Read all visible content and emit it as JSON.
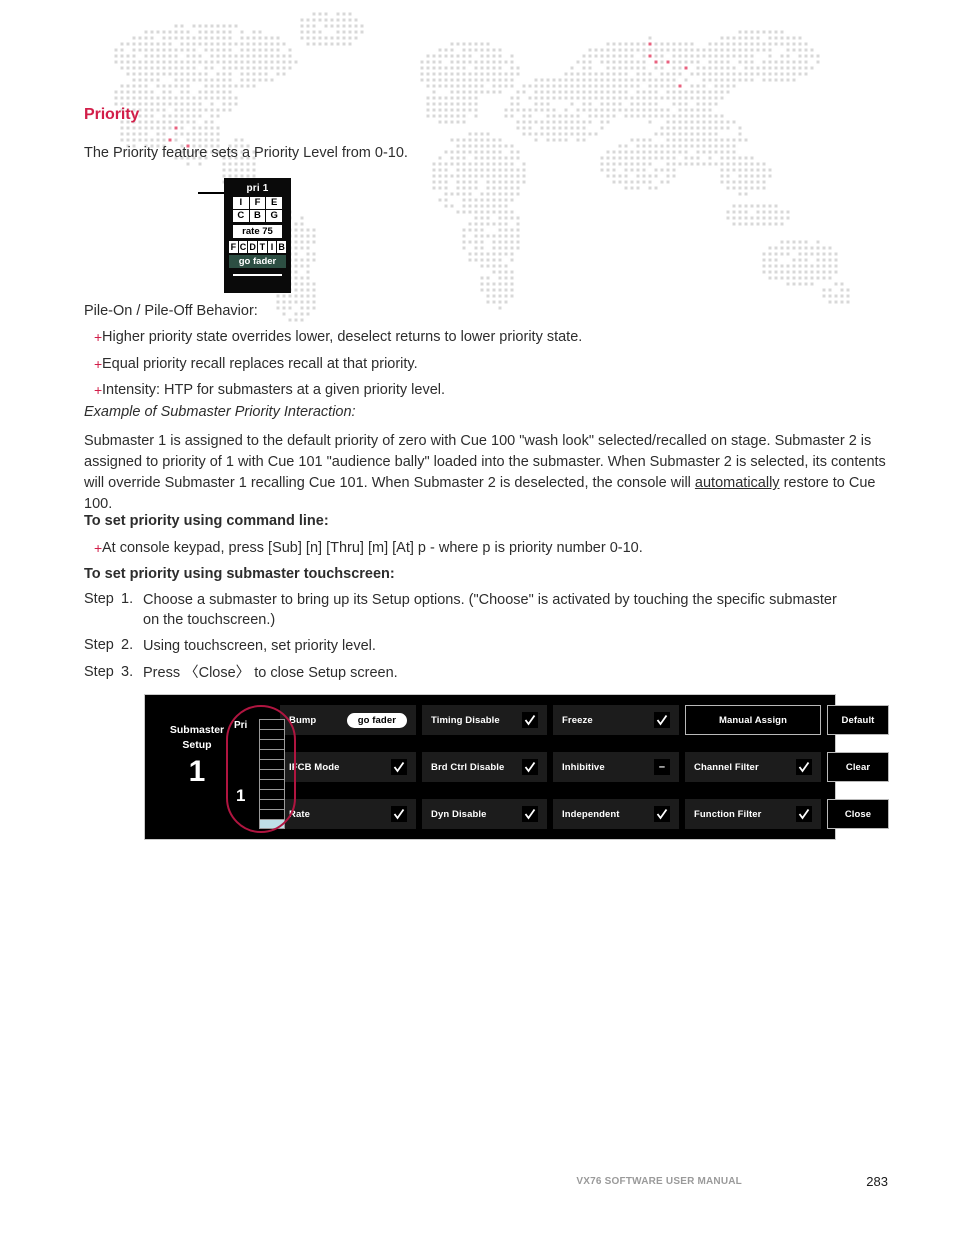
{
  "document": {
    "heading": "Priority",
    "intro": "The Priority feature sets a Priority Level from 0-10."
  },
  "fader_widget": {
    "pri_label": "pri 1",
    "ifcb_grid": [
      "I",
      "F",
      "E",
      "C",
      "B",
      "G"
    ],
    "rate": "rate 75",
    "fcdtib": [
      "F",
      "C",
      "D",
      "T",
      "I",
      "B"
    ],
    "go_fader": "go fader"
  },
  "pile_section": {
    "heading": "Pile-On / Pile-Off Behavior:",
    "bullets": [
      "Higher priority state overrides lower, deselect returns to lower priority state.",
      "Equal priority recall replaces recall at that priority.",
      "Intensity: HTP for submasters at a given priority level."
    ]
  },
  "example": {
    "heading": "Example of Submaster Priority Interaction:",
    "paragraph_part1": "Submaster 1 is assigned to the default priority of zero with Cue 100 \"wash look\" selected/recalled on stage. Submaster 2 is assigned to priority of 1 with Cue 101 \"audience bally\" loaded into the submaster. When Submaster 2 is selected, its contents will override Submaster 1 recalling Cue 101. When Submaster 2 is deselected, the console will ",
    "paragraph_underlined": "automatically",
    "paragraph_part2": " restore to Cue 100."
  },
  "command_line": {
    "heading": "To set priority using command line:",
    "bullets": [
      "At console keypad, press [Sub] [n] [Thru] [m] [At] p - where p is priority number 0-10."
    ]
  },
  "touchscreen_steps": {
    "heading": "To set priority using submaster touchscreen:",
    "step_word": "Step",
    "steps": [
      {
        "num": "1.",
        "text": "Choose a submaster to bring up its Setup options. (\"Choose\" is activated by touching the specific submaster on the touchscreen.)"
      },
      {
        "num": "2.",
        "text": "Using touchscreen, set priority level."
      },
      {
        "num": "3.",
        "text": "Press 〈Close〉 to close Setup screen."
      }
    ]
  },
  "touchscreen_panel": {
    "title_line1": "Submaster",
    "title_line2": "Setup",
    "submaster_number": "1",
    "priority": {
      "label": "Pri",
      "value": "1",
      "scale_cells": 11,
      "active_cell_index": 10,
      "highlight_color": "#bfe0e8",
      "annotation_color": "#b01540"
    },
    "columns": [
      {
        "buttons": [
          {
            "label": "Bump",
            "control": "pill",
            "pill_label": "go fader"
          },
          {
            "label": "IFCB Mode",
            "control": "check"
          },
          {
            "label": "Rate",
            "control": "check"
          }
        ]
      },
      {
        "buttons": [
          {
            "label": "Timing Disable",
            "control": "check"
          },
          {
            "label": "Brd Ctrl Disable",
            "control": "check"
          },
          {
            "label": "Dyn Disable",
            "control": "check"
          }
        ]
      },
      {
        "buttons": [
          {
            "label": "Freeze",
            "control": "check"
          },
          {
            "label": "Inhibitive",
            "control": "dash"
          },
          {
            "label": "Independent",
            "control": "check"
          }
        ]
      },
      {
        "buttons": [
          {
            "label": "Manual Assign",
            "control": "none",
            "style": "outlined"
          },
          {
            "label": "Channel Filter",
            "control": "check"
          },
          {
            "label": "Function Filter",
            "control": "check"
          }
        ]
      },
      {
        "buttons": [
          {
            "label": "Default",
            "control": "none",
            "style": "outlined"
          },
          {
            "label": "Clear",
            "control": "none",
            "style": "outlined"
          },
          {
            "label": "Close",
            "control": "none",
            "style": "outlined"
          }
        ]
      }
    ]
  },
  "footer": {
    "manual_title": "VX76 SOFTWARE USER MANUAL",
    "page_number": "283"
  }
}
